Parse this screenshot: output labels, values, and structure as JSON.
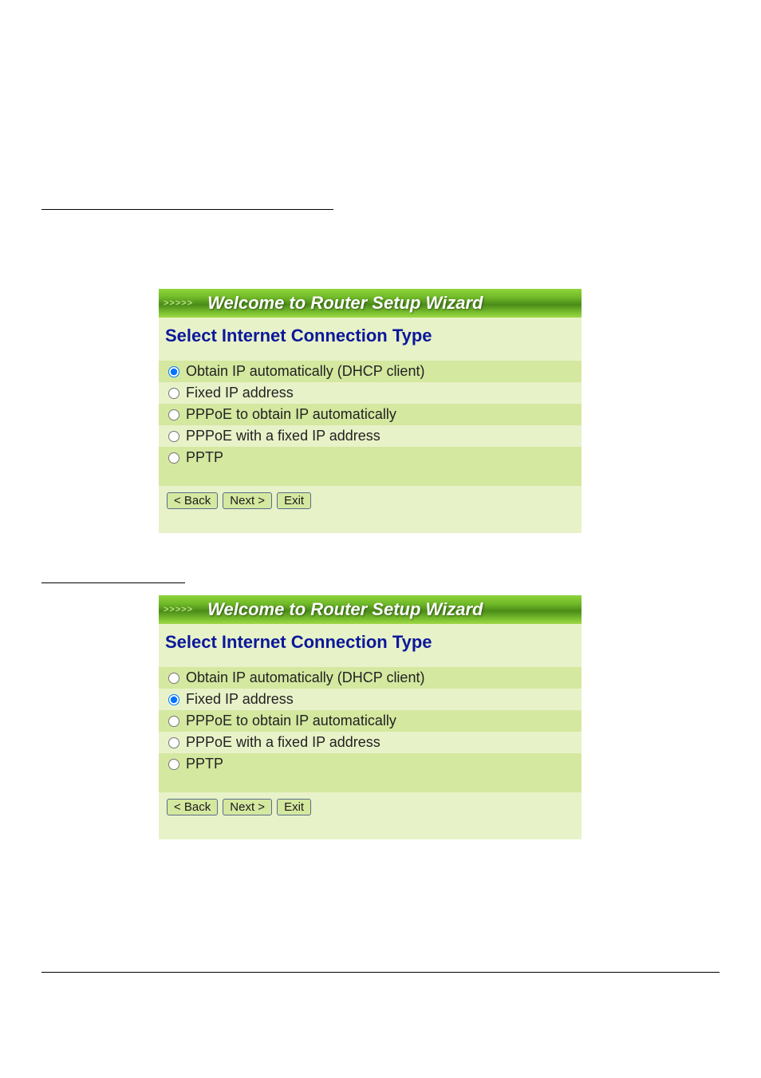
{
  "panel1": {
    "header_chevrons": ">>>>>",
    "header_title": "Welcome to Router Setup Wizard",
    "heading": "Select Internet Connection Type",
    "options": {
      "opt0": "Obtain IP automatically (DHCP client)",
      "opt1": "Fixed IP address",
      "opt2": "PPPoE to obtain IP automatically",
      "opt3": "PPPoE with a fixed IP address",
      "opt4": "PPTP"
    },
    "buttons": {
      "back": "< Back",
      "next": "Next >",
      "exit": "Exit"
    }
  },
  "panel2": {
    "header_chevrons": ">>>>>",
    "header_title": "Welcome to Router Setup Wizard",
    "heading": "Select Internet Connection Type",
    "options": {
      "opt0": "Obtain IP automatically (DHCP client)",
      "opt1": "Fixed IP address",
      "opt2": "PPPoE to obtain IP automatically",
      "opt3": "PPPoE with a fixed IP address",
      "opt4": "PPTP"
    },
    "buttons": {
      "back": "< Back",
      "next": "Next >",
      "exit": "Exit"
    }
  }
}
